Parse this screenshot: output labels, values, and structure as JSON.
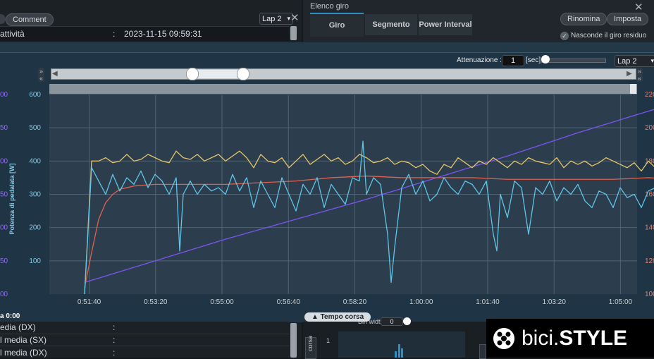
{
  "top_left": {
    "comment_tab": "Comment",
    "lap_select": "Lap 2",
    "activity_label": "attività",
    "activity_sep": ":",
    "activity_value": "2023-11-15 09:59:31"
  },
  "top_right": {
    "title": "Elenco giro",
    "tabs": [
      "Giro",
      "Segmento",
      "Power Interval"
    ],
    "rename_button": "Rinomina",
    "set_button": "Imposta",
    "hide_residual_label": "Nasconde il giro residuo"
  },
  "toolbar": {
    "attenuation_label": "Attenuazione :",
    "attenuation_value": "1",
    "attenuation_unit": "[sec]",
    "attenuation_slider_fraction": 0.0,
    "lap_select": "Lap 2"
  },
  "range_slider": {
    "start_fraction": 0.24,
    "end_fraction": 0.33
  },
  "bottom_left": {
    "time_label": "a 0:00",
    "rows": [
      {
        "label": "edia (DX)",
        "sep": ":"
      },
      {
        "label": "l media (SX)",
        "sep": ":"
      },
      {
        "label": "l media (DX)",
        "sep": ":"
      }
    ]
  },
  "bottom_center": {
    "tempo_button": "▲ Tempo corsa",
    "bin_label": "Bin width",
    "bin_value": "0",
    "axis_label": "corsa",
    "histogram_tick": "1"
  },
  "brand": {
    "name_light": "bici.",
    "name_bold": "STYLE"
  },
  "colors": {
    "power": "#5fc4e6",
    "cadence": "#e5c56a",
    "heart_rate": "#e0604f",
    "distance": "#7b55f0",
    "accent": "#2f8ec4"
  },
  "chart_data": {
    "type": "line",
    "title": "",
    "xlabel": "",
    "ylabel": "Potenza di pedalata [W]",
    "x_ticks": [
      "0:51:40",
      "0:53:20",
      "0:55:00",
      "0:56:40",
      "0:58:20",
      "1:00:00",
      "1:01:40",
      "1:03:20",
      "1:05:00"
    ],
    "xlim": [
      "0:50:40",
      "1:05:25"
    ],
    "ylim": [
      0,
      600
    ],
    "y_ticks": [
      100,
      200,
      300,
      400,
      500,
      600
    ],
    "right_axis": {
      "ylim": [
        100,
        220
      ],
      "ticks": [
        100,
        120,
        140,
        160,
        180,
        200,
        220
      ],
      "label": ""
    },
    "far_left_axis_partial_ticks": [
      "00",
      "50",
      "00",
      "50",
      "00",
      "50",
      "00"
    ],
    "grid": true,
    "series": [
      {
        "axis": "left",
        "values": [
          [
            50,
            0
          ],
          [
            60,
            380
          ],
          [
            70,
            340
          ],
          [
            80,
            300
          ],
          [
            90,
            360
          ],
          [
            100,
            310
          ],
          [
            110,
            350
          ],
          [
            120,
            330
          ],
          [
            130,
            370
          ],
          [
            140,
            320
          ],
          [
            150,
            360
          ],
          [
            160,
            340
          ],
          [
            170,
            300
          ],
          [
            180,
            350
          ],
          [
            185,
            130
          ],
          [
            190,
            300
          ],
          [
            200,
            340
          ],
          [
            210,
            300
          ],
          [
            220,
            330
          ],
          [
            230,
            310
          ],
          [
            240,
            320
          ],
          [
            250,
            300
          ],
          [
            260,
            360
          ],
          [
            270,
            310
          ],
          [
            280,
            350
          ],
          [
            290,
            260
          ],
          [
            300,
            340
          ],
          [
            310,
            300
          ],
          [
            320,
            260
          ],
          [
            330,
            350
          ],
          [
            340,
            300
          ],
          [
            350,
            250
          ],
          [
            360,
            330
          ],
          [
            370,
            300
          ],
          [
            380,
            350
          ],
          [
            390,
            260
          ],
          [
            400,
            330
          ],
          [
            410,
            300
          ],
          [
            420,
            270
          ],
          [
            430,
            350
          ],
          [
            440,
            340
          ],
          [
            445,
            460
          ],
          [
            450,
            300
          ],
          [
            460,
            350
          ],
          [
            470,
            330
          ],
          [
            480,
            180
          ],
          [
            485,
            35
          ],
          [
            490,
            140
          ],
          [
            500,
            320
          ],
          [
            510,
            360
          ],
          [
            520,
            300
          ],
          [
            530,
            340
          ],
          [
            540,
            280
          ],
          [
            550,
            300
          ],
          [
            560,
            350
          ],
          [
            570,
            320
          ],
          [
            580,
            300
          ],
          [
            590,
            340
          ],
          [
            600,
            330
          ],
          [
            610,
            300
          ],
          [
            620,
            340
          ],
          [
            630,
            180
          ],
          [
            635,
            130
          ],
          [
            640,
            300
          ],
          [
            650,
            230
          ],
          [
            660,
            340
          ],
          [
            670,
            320
          ],
          [
            680,
            180
          ],
          [
            690,
            320
          ],
          [
            700,
            300
          ],
          [
            710,
            340
          ],
          [
            720,
            280
          ],
          [
            730,
            320
          ],
          [
            740,
            300
          ],
          [
            750,
            330
          ],
          [
            760,
            280
          ],
          [
            770,
            260
          ],
          [
            780,
            310
          ],
          [
            790,
            300
          ],
          [
            800,
            260
          ],
          [
            810,
            320
          ],
          [
            820,
            290
          ],
          [
            830,
            300
          ],
          [
            840,
            260
          ],
          [
            850,
            310
          ],
          [
            860,
            320
          ],
          [
            870,
            300
          ],
          [
            880,
            210
          ],
          [
            890,
            150
          ]
        ]
      },
      {
        "axis": "left",
        "values": [
          [
            50,
            0
          ],
          [
            60,
            400
          ],
          [
            70,
            400
          ],
          [
            80,
            410
          ],
          [
            90,
            395
          ],
          [
            100,
            400
          ],
          [
            110,
            420
          ],
          [
            120,
            400
          ],
          [
            130,
            405
          ],
          [
            140,
            420
          ],
          [
            150,
            410
          ],
          [
            160,
            400
          ],
          [
            170,
            395
          ],
          [
            180,
            430
          ],
          [
            190,
            410
          ],
          [
            200,
            405
          ],
          [
            210,
            420
          ],
          [
            220,
            400
          ],
          [
            230,
            410
          ],
          [
            240,
            420
          ],
          [
            250,
            400
          ],
          [
            260,
            415
          ],
          [
            270,
            430
          ],
          [
            280,
            410
          ],
          [
            290,
            380
          ],
          [
            300,
            420
          ],
          [
            310,
            400
          ],
          [
            320,
            395
          ],
          [
            330,
            410
          ],
          [
            340,
            380
          ],
          [
            350,
            400
          ],
          [
            360,
            420
          ],
          [
            370,
            390
          ],
          [
            380,
            405
          ],
          [
            390,
            420
          ],
          [
            400,
            400
          ],
          [
            410,
            410
          ],
          [
            420,
            390
          ],
          [
            430,
            400
          ],
          [
            440,
            420
          ],
          [
            450,
            410
          ],
          [
            460,
            395
          ],
          [
            470,
            400
          ],
          [
            480,
            410
          ],
          [
            490,
            390
          ],
          [
            500,
            400
          ],
          [
            510,
            395
          ],
          [
            520,
            380
          ],
          [
            530,
            390
          ],
          [
            540,
            370
          ],
          [
            550,
            360
          ],
          [
            560,
            390
          ],
          [
            570,
            380
          ],
          [
            580,
            410
          ],
          [
            590,
            395
          ],
          [
            600,
            380
          ],
          [
            610,
            400
          ],
          [
            620,
            390
          ],
          [
            630,
            410
          ],
          [
            640,
            395
          ],
          [
            650,
            380
          ],
          [
            660,
            400
          ],
          [
            670,
            390
          ],
          [
            680,
            410
          ],
          [
            690,
            400
          ],
          [
            700,
            395
          ],
          [
            710,
            390
          ],
          [
            720,
            410
          ],
          [
            730,
            380
          ],
          [
            740,
            400
          ],
          [
            750,
            390
          ],
          [
            760,
            400
          ],
          [
            770,
            385
          ],
          [
            780,
            395
          ],
          [
            790,
            410
          ],
          [
            800,
            400
          ],
          [
            810,
            390
          ],
          [
            820,
            380
          ],
          [
            830,
            395
          ],
          [
            840,
            370
          ],
          [
            850,
            400
          ],
          [
            860,
            380
          ],
          [
            870,
            440
          ],
          [
            880,
            440
          ],
          [
            890,
            430
          ]
        ]
      },
      {
        "axis": "right",
        "values": [
          [
            50,
            104
          ],
          [
            60,
            125
          ],
          [
            70,
            145
          ],
          [
            80,
            155
          ],
          [
            90,
            160
          ],
          [
            100,
            163
          ],
          [
            110,
            164
          ],
          [
            120,
            165
          ],
          [
            150,
            166
          ],
          [
            200,
            166
          ],
          [
            250,
            166
          ],
          [
            300,
            167
          ],
          [
            350,
            168
          ],
          [
            400,
            170
          ],
          [
            450,
            171
          ],
          [
            500,
            170
          ],
          [
            550,
            170
          ],
          [
            600,
            170
          ],
          [
            650,
            169
          ],
          [
            700,
            169
          ],
          [
            750,
            169
          ],
          [
            800,
            169
          ],
          [
            850,
            170
          ],
          [
            890,
            169
          ]
        ]
      },
      {
        "axis": "right",
        "values": [
          [
            50,
            107
          ],
          [
            150,
            120
          ],
          [
            250,
            133
          ],
          [
            350,
            145
          ],
          [
            450,
            157
          ],
          [
            550,
            170
          ],
          [
            650,
            183
          ],
          [
            750,
            197
          ],
          [
            850,
            210
          ],
          [
            890,
            215
          ]
        ]
      }
    ]
  }
}
